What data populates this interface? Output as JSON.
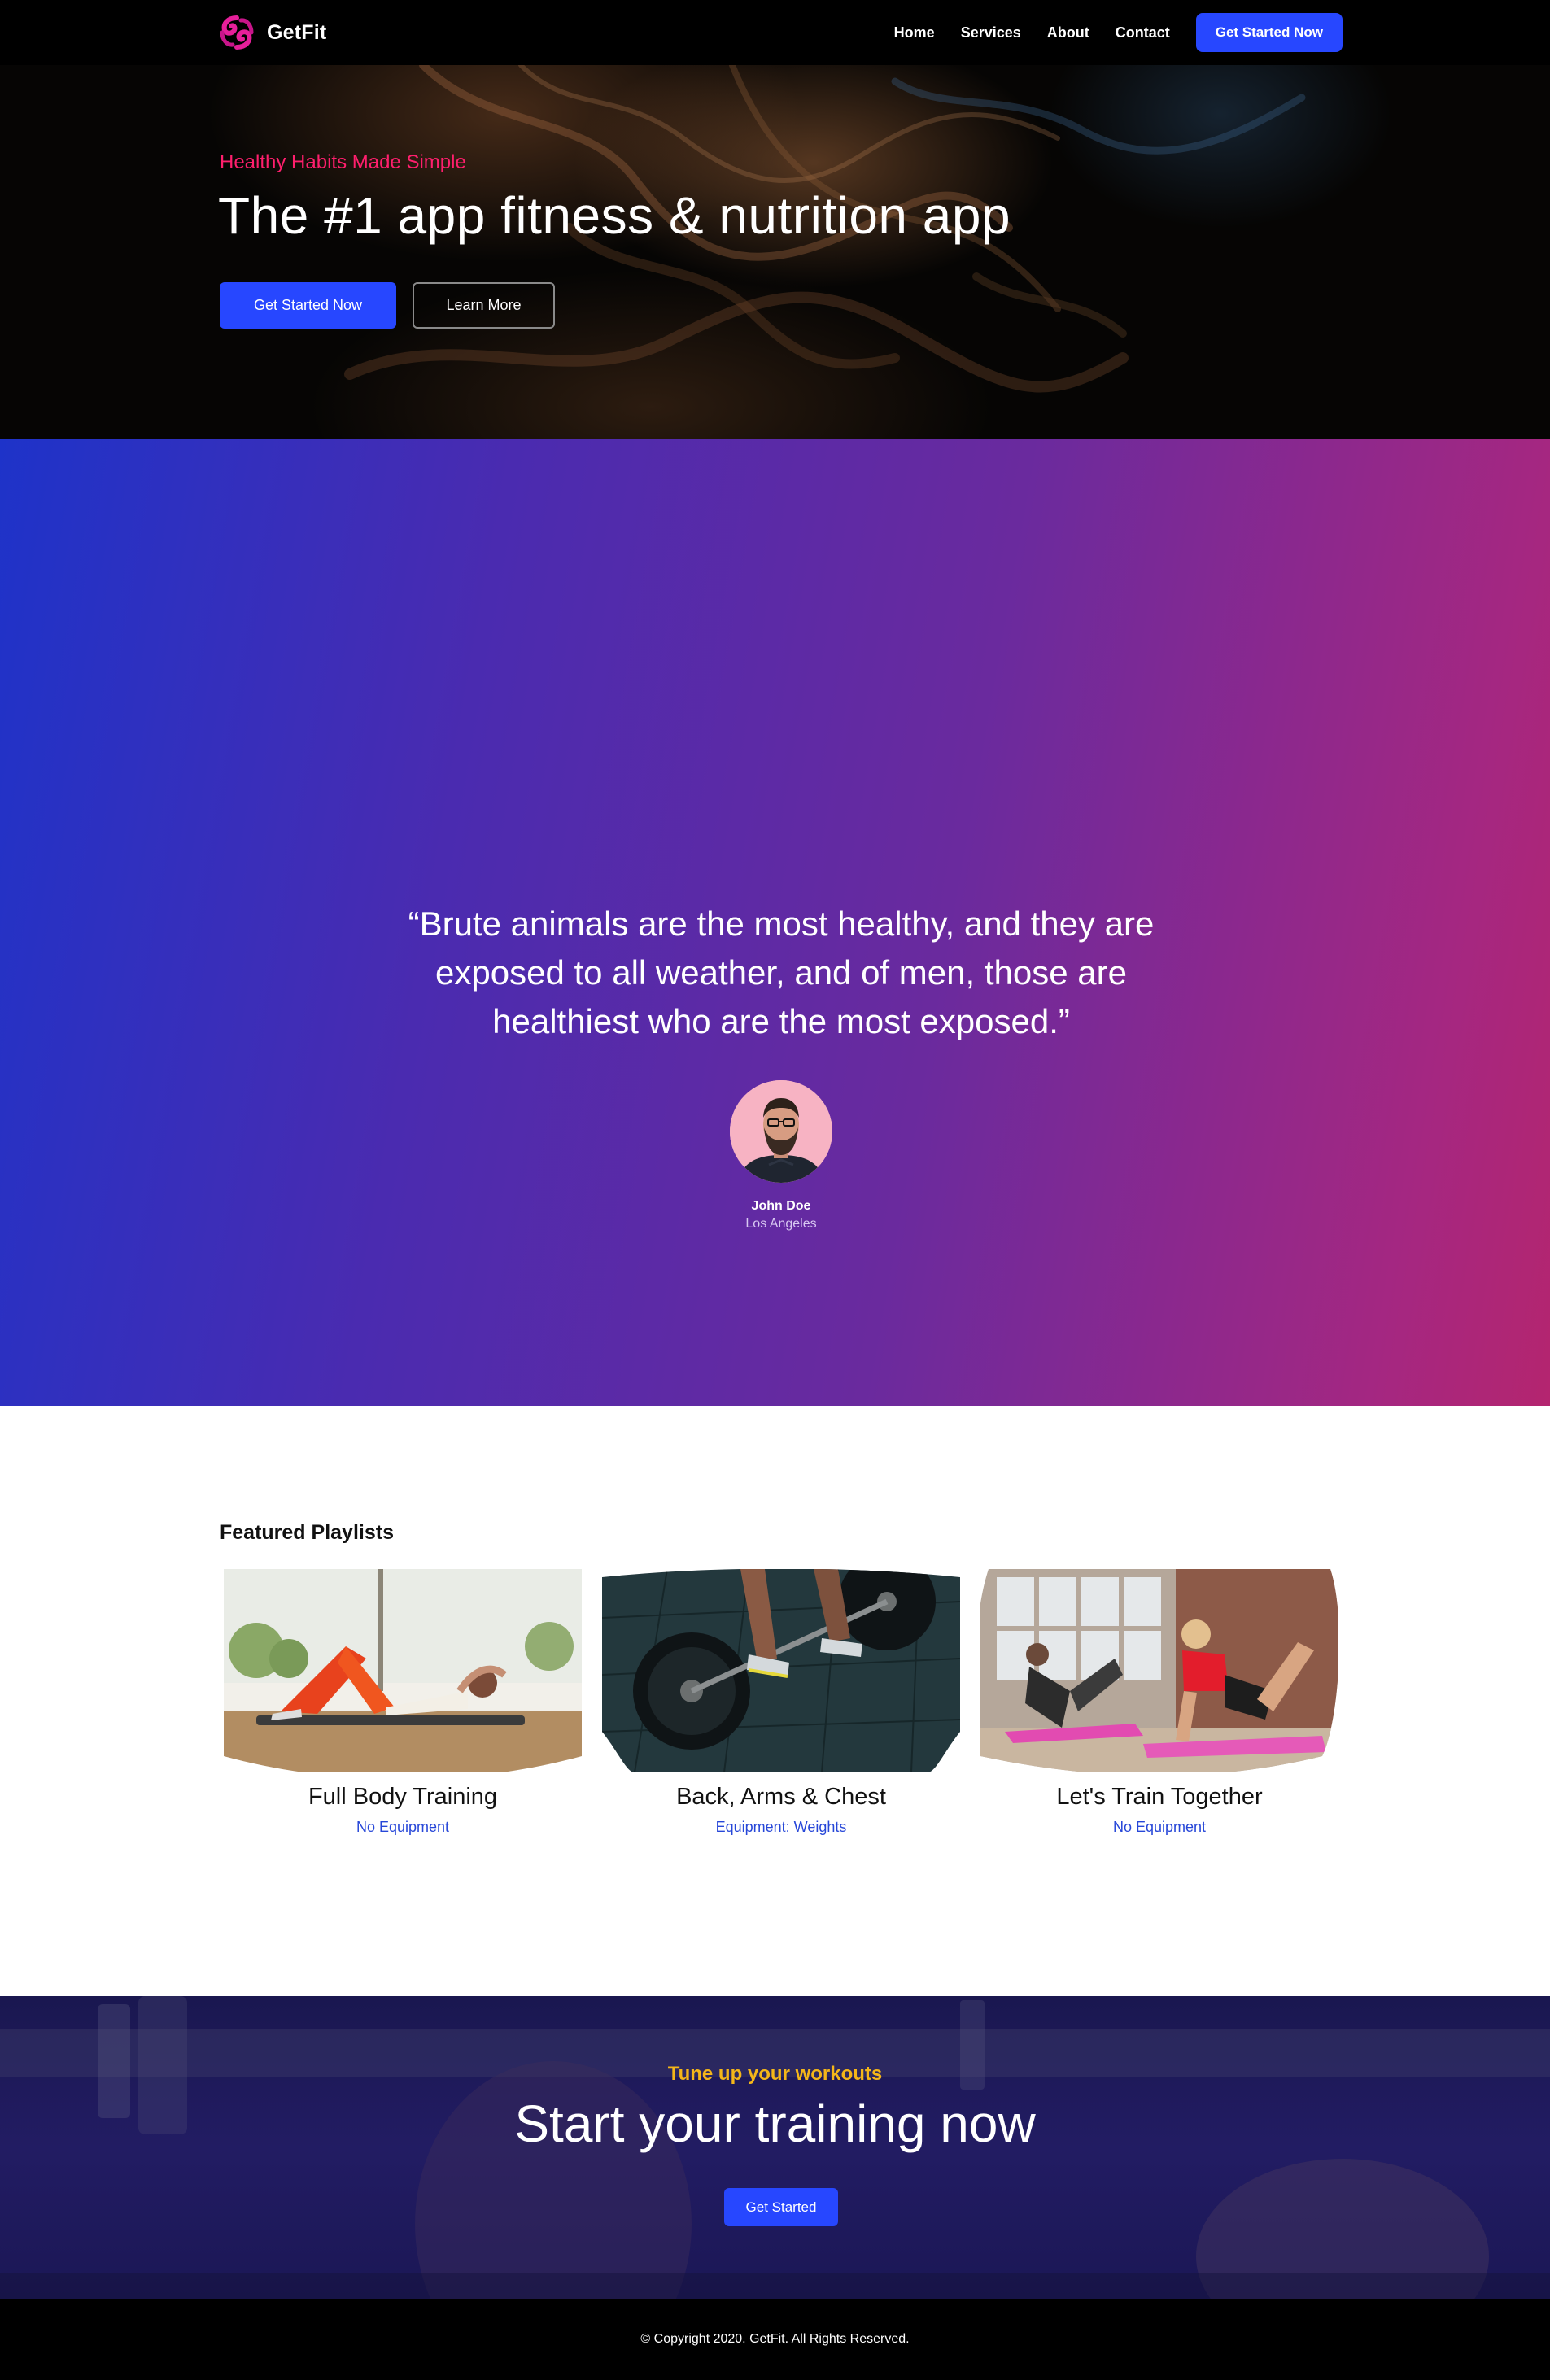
{
  "nav": {
    "brand": "GetFit",
    "links": [
      "Home",
      "Services",
      "About",
      "Contact"
    ],
    "cta": "Get Started Now"
  },
  "hero": {
    "eyebrow": "Healthy Habits Made Simple",
    "title": "The #1 app fitness & nutrition app",
    "primary_button": "Get Started Now",
    "secondary_button": "Learn More"
  },
  "testimonial": {
    "quote": "“Brute animals are the most healthy, and they are exposed to all weather, and of men, those are healthiest who are the most exposed.”",
    "name": "John Doe",
    "location": "Los Angeles"
  },
  "playlists": {
    "heading": "Featured Playlists",
    "items": [
      {
        "title": "Full Body Training",
        "subtitle": "No Equipment"
      },
      {
        "title": "Back, Arms & Chest",
        "subtitle": "Equipment: Weights"
      },
      {
        "title": "Let's Train Together",
        "subtitle": "No Equipment"
      }
    ]
  },
  "cta": {
    "eyebrow": "Tune up your workouts",
    "title": "Start your training now",
    "button": "Get Started"
  },
  "footer": {
    "copyright": "© Copyright 2020. GetFit. All Rights Reserved."
  },
  "colors": {
    "accent_blue": "#2747ff",
    "hero_eyebrow": "#ff1f6d",
    "cta_eyebrow": "#f4b619",
    "brand_logo": "#e61f9a"
  },
  "icons": {
    "logo": "getfit-logo-icon"
  }
}
